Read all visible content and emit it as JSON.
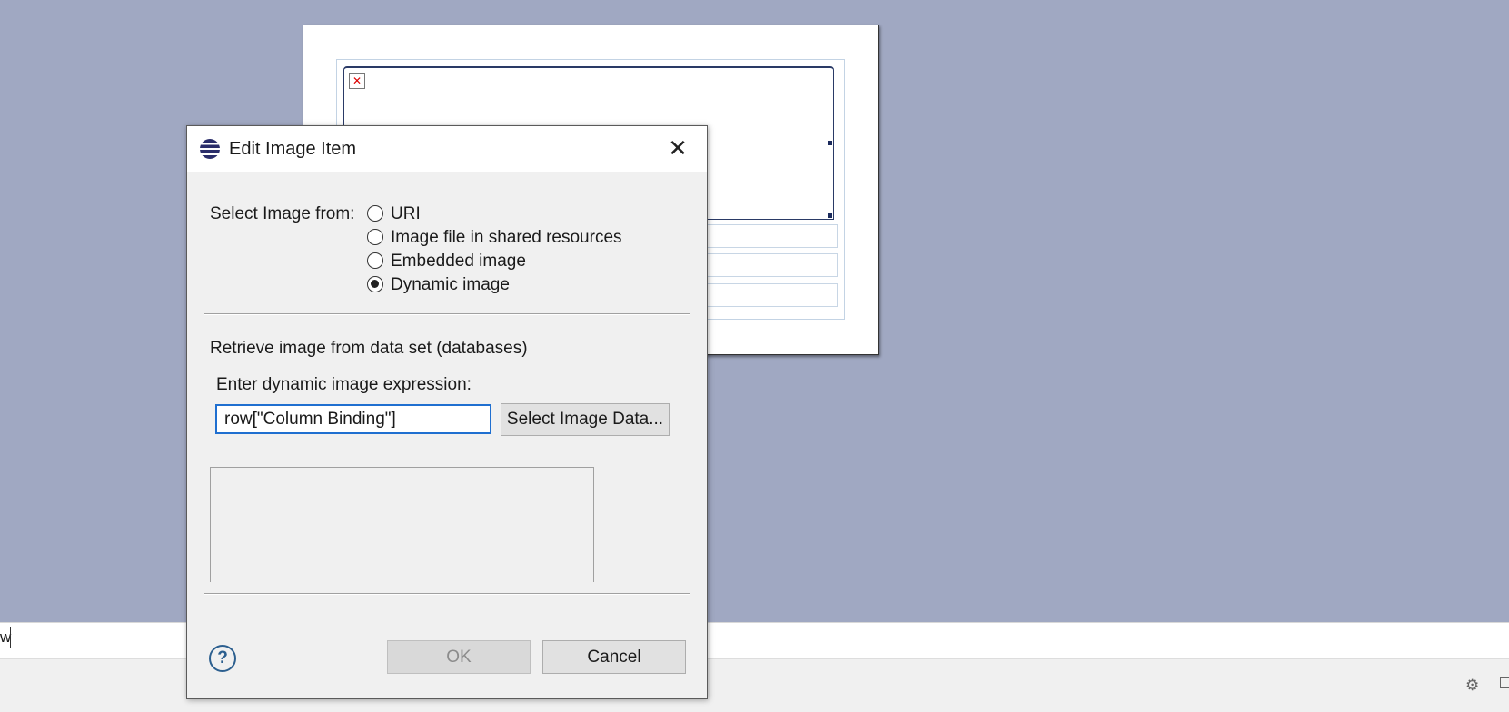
{
  "dialog": {
    "title": "Edit Image Item",
    "select_from_label": "Select Image from:",
    "options": [
      {
        "label": "URI",
        "selected": false
      },
      {
        "label": "Image file in shared resources",
        "selected": false
      },
      {
        "label": "Embedded image",
        "selected": false
      },
      {
        "label": "Dynamic image",
        "selected": true
      }
    ],
    "section_label": "Retrieve image from data set (databases)",
    "expression_label": "Enter dynamic image expression:",
    "expression_value": "row[\"Column Binding\"]",
    "select_data_button": "Select Image Data...",
    "ok_button": "OK",
    "cancel_button": "Cancel",
    "help_icon": "?"
  },
  "background": {
    "partial_text": "w",
    "broken_image_glyph": "✕",
    "status_icon": "⚙"
  },
  "icons": [
    "eclipse-app-icon",
    "close-icon",
    "help-icon",
    "broken-image-icon"
  ]
}
